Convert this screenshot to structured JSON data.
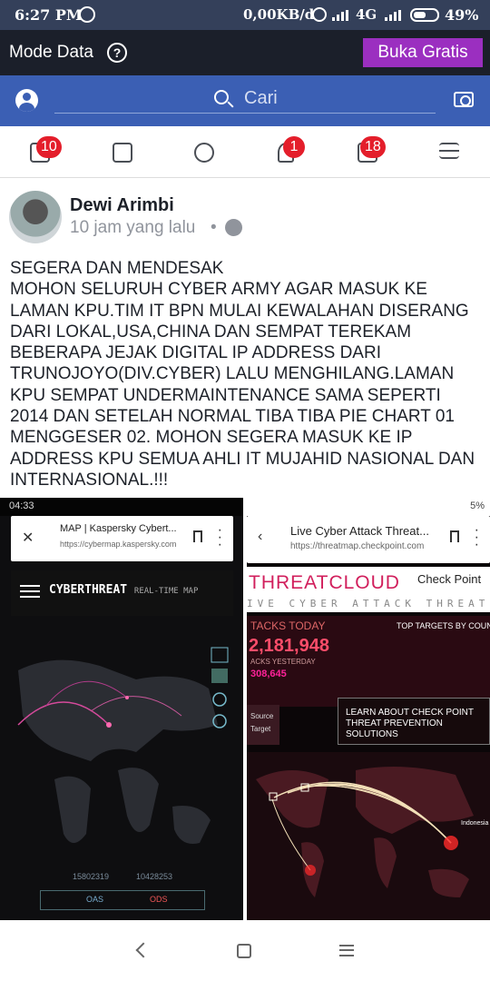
{
  "status_bar": {
    "time": "6:27 PM",
    "network_speed": "0,00KB/d",
    "network_type": "4G",
    "battery": "49%"
  },
  "mode_bar": {
    "label": "Mode Data",
    "cta": "Buka Gratis"
  },
  "search": {
    "placeholder": "Cari"
  },
  "tabs": {
    "news_feed_badge": "10",
    "notifications_badge": "1",
    "marketplace_badge": "18"
  },
  "post": {
    "author": "Dewi Arimbi",
    "time": "10 jam yang lalu",
    "separator": "•",
    "lines": [
      "SEGERA DAN MENDESAK",
      "MOHON SELURUH CYBER ARMY AGAR MASUK KE",
      "LAMAN KPU.TIM IT BPN MULAI KEWALAHAN DISERANG",
      "DARI LOKAL,USA,CHINA DAN SEMPAT TEREKAM",
      "BEBERAPA JEJAK DIGITAL IP ADDRESS DARI",
      "TRUNOJOYO(DIV.CYBER) LALU MENGHILANG.LAMAN",
      "KPU SEMPAT UNDERMAINTENANCE SAMA SEPERTI",
      "2014 DAN SETELAH NORMAL TIBA TIBA PIE CHART 01",
      "MENGGESER 02. MOHON SEGERA MASUK KE IP",
      "ADDRESS KPU SEMUA AHLI IT MUJAHID NASIONAL DAN",
      "INTERNASIONAL.!!!"
    ]
  },
  "photo_left": {
    "status_time": "04:33",
    "tab_title": "MAP | Kaspersky Cybert...",
    "url": "https://cybermap.kaspersky.com",
    "header_title": "CYBERTHREAT",
    "header_subtitle": "REAL-TIME MAP",
    "stat_a": "15802319",
    "stat_b": "10428253",
    "label_oas": "OAS",
    "label_ods": "ODS"
  },
  "photo_right": {
    "status_battery": "5%",
    "tab_title": "Live Cyber Attack Threat...",
    "url": "https://threatmap.checkpoint.com",
    "logo_text": "THREATCLOUD",
    "brand": "Check Point",
    "subtitle": "IVE CYBER ATTACK THREAT M",
    "attacks_label": "TACKS TODAY",
    "top_targets": "TOP TARGETS BY COUN",
    "attacks_count": "2,181,948",
    "yesterday_label": "ACKS YESTERDAY",
    "yesterday_count": "308,645",
    "source_label": "Source",
    "target_label": "Target",
    "promo": "LEARN ABOUT CHECK POINT THREAT PREVENTION SOLUTIONS",
    "country_label": "Indonesia"
  },
  "colors": {
    "facebook_blue": "#3b5fb4",
    "badge_red": "#e41e2b",
    "cta_purple": "#9b2fc0",
    "threat_pink": "#d11f5c"
  }
}
